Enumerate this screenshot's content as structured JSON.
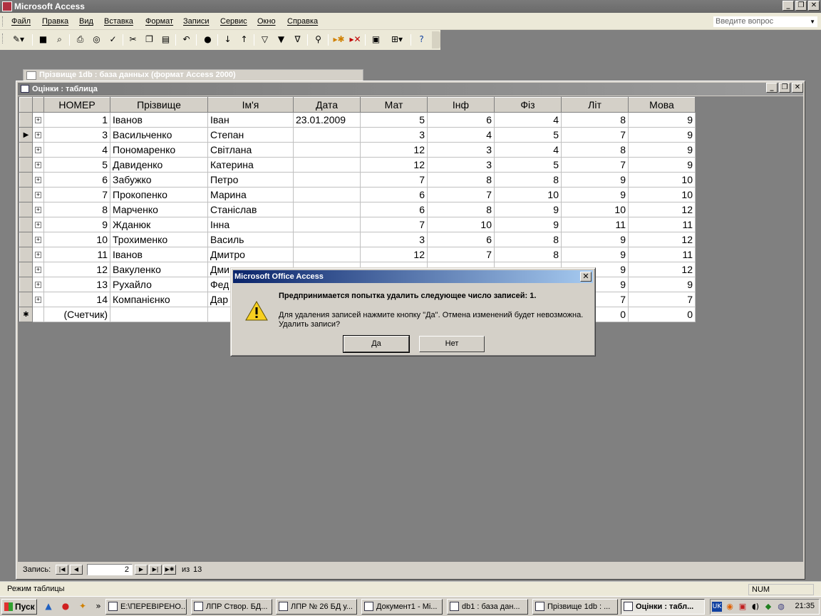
{
  "app": {
    "title": "Microsoft Access"
  },
  "window_buttons": {
    "minimize": "_",
    "restore": "❐",
    "close": "✕"
  },
  "menu": [
    "Файл",
    "Правка",
    "Вид",
    "Вставка",
    "Формат",
    "Записи",
    "Сервис",
    "Окно",
    "Справка"
  ],
  "ask_box": {
    "placeholder": "Введите вопрос"
  },
  "toolbar_icons": [
    "view-icon",
    "save-icon",
    "search-db-icon",
    "print-icon",
    "print-preview-icon",
    "spelling-icon",
    "cut-icon",
    "copy-icon",
    "paste-icon",
    "undo-icon",
    "hyperlink-icon",
    "sort-asc-icon",
    "sort-desc-icon",
    "filter-by-selection-icon",
    "filter-by-form-icon",
    "apply-filter-icon",
    "find-icon",
    "new-record-icon",
    "delete-record-icon",
    "database-window-icon",
    "new-object-icon",
    "help-icon"
  ],
  "ghost_window": {
    "title": "Прізвище 1db : база данных (формат Access 2000)"
  },
  "table_window": {
    "title": "Оцінки : таблица"
  },
  "table": {
    "columns": [
      "НОМЕР",
      "Прізвище",
      "Ім'я",
      "Дата",
      "Мат",
      "Інф",
      "Фіз",
      "Літ",
      "Мова"
    ],
    "rows": [
      [
        "1",
        "Іванов",
        "Іван",
        "23.01.2009",
        "5",
        "6",
        "4",
        "8",
        "9"
      ],
      [
        "3",
        "Васильченко",
        "Степан",
        "",
        "3",
        "4",
        "5",
        "7",
        "9"
      ],
      [
        "4",
        "Пономаренко",
        "Світлана",
        "",
        "12",
        "3",
        "4",
        "8",
        "9"
      ],
      [
        "5",
        "Давиденко",
        "Катерина",
        "",
        "12",
        "3",
        "5",
        "7",
        "9"
      ],
      [
        "6",
        "Забужко",
        "Петро",
        "",
        "7",
        "8",
        "8",
        "9",
        "10"
      ],
      [
        "7",
        "Прокопенко",
        "Марина",
        "",
        "6",
        "7",
        "10",
        "9",
        "10"
      ],
      [
        "8",
        "Марченко",
        "Станіслав",
        "",
        "6",
        "8",
        "9",
        "10",
        "12"
      ],
      [
        "9",
        "Жданюк",
        "Інна",
        "",
        "7",
        "10",
        "9",
        "11",
        "11"
      ],
      [
        "10",
        "Трохименко",
        "Василь",
        "",
        "3",
        "6",
        "8",
        "9",
        "12"
      ],
      [
        "11",
        "Іванов",
        "Дмитро",
        "",
        "12",
        "7",
        "8",
        "9",
        "11"
      ],
      [
        "12",
        "Вакуленко",
        "Дми",
        "",
        "",
        "",
        "",
        "9",
        "12"
      ],
      [
        "13",
        "Рухайло",
        "Фед",
        "",
        "",
        "",
        "",
        "9",
        "9"
      ],
      [
        "14",
        "Компанієнко",
        "Дар",
        "",
        "",
        "",
        "",
        "7",
        "7"
      ]
    ],
    "new_row": [
      "(Счетчик)",
      "",
      "",
      "",
      "",
      "",
      "",
      "0",
      "0"
    ],
    "current_row_index": 1
  },
  "navigator": {
    "label": "Запись:",
    "current": "2",
    "of_label": "из",
    "total": "13"
  },
  "status": {
    "mode": "Режим таблицы",
    "num": "NUM"
  },
  "dialog": {
    "title": "Microsoft Office Access",
    "message": "Предпринимается попытка удалить следующее число записей: 1.",
    "detail": "Для удаления записей нажмите кнопку \"Да\". Отмена изменений будет невозможна. Удалить записи?",
    "yes": "Да",
    "no": "Нет"
  },
  "taskbar": {
    "start": "Пуск",
    "more": "»",
    "tasks": [
      {
        "label": "E:\\ПЕРЕВІРЕНО..."
      },
      {
        "label": "ЛПР Створ. БД..."
      },
      {
        "label": "ЛПР № 26 БД у..."
      },
      {
        "label": "Документ1 - Mi..."
      },
      {
        "label": "db1 : база дан..."
      },
      {
        "label": "Прізвище 1db : ..."
      },
      {
        "label": "Оцінки : табл..."
      }
    ],
    "tray": {
      "lang": "UK",
      "clock": "21:35"
    }
  }
}
